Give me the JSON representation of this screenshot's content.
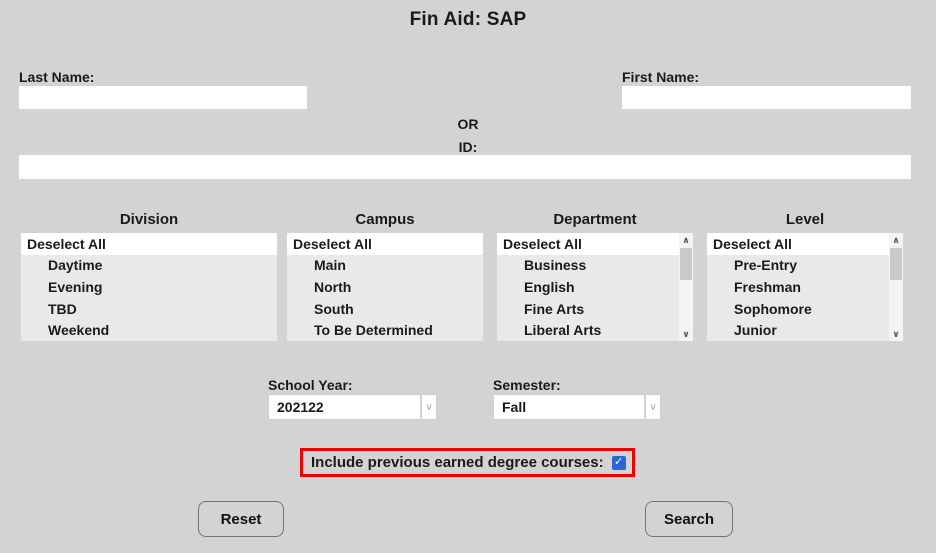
{
  "title": "Fin Aid: SAP",
  "fields": {
    "last_name": {
      "label": "Last Name:",
      "value": ""
    },
    "first_name": {
      "label": "First Name:",
      "value": ""
    },
    "or_text": "OR",
    "id": {
      "label": "ID:",
      "value": ""
    }
  },
  "listboxes": [
    {
      "header": "Division",
      "selected": "Deselect All",
      "has_scrollbar": false,
      "items": [
        "Deselect All",
        "Daytime",
        "Evening",
        "TBD",
        "Weekend"
      ]
    },
    {
      "header": "Campus",
      "selected": "Deselect All",
      "has_scrollbar": false,
      "items": [
        "Deselect All",
        "Main",
        "North",
        "South",
        "To Be Determined"
      ]
    },
    {
      "header": "Department",
      "selected": "Deselect All",
      "has_scrollbar": true,
      "items": [
        "Deselect All",
        "Business",
        "English",
        "Fine Arts",
        "Liberal Arts"
      ]
    },
    {
      "header": "Level",
      "selected": "Deselect All",
      "has_scrollbar": true,
      "items": [
        "Deselect All",
        "Pre-Entry",
        "Freshman",
        "Sophomore",
        "Junior"
      ]
    }
  ],
  "dropdowns": {
    "school_year": {
      "label": "School Year:",
      "value": "202122"
    },
    "semester": {
      "label": "Semester:",
      "value": "Fall"
    }
  },
  "checkbox": {
    "label": "Include previous earned degree courses:",
    "checked": true
  },
  "buttons": {
    "reset": "Reset",
    "search": "Search"
  },
  "icons": {
    "scroll_up": "∧",
    "scroll_down": "∨",
    "dropdown_caret": "∨"
  },
  "colors": {
    "page-bg": "#d3d3d3",
    "list-bg": "#e9e9e9",
    "selected-bg": "#ffffff",
    "accent-blue": "#2a66d4",
    "highlight-red": "#ee0000",
    "btn-border": "#757575"
  }
}
